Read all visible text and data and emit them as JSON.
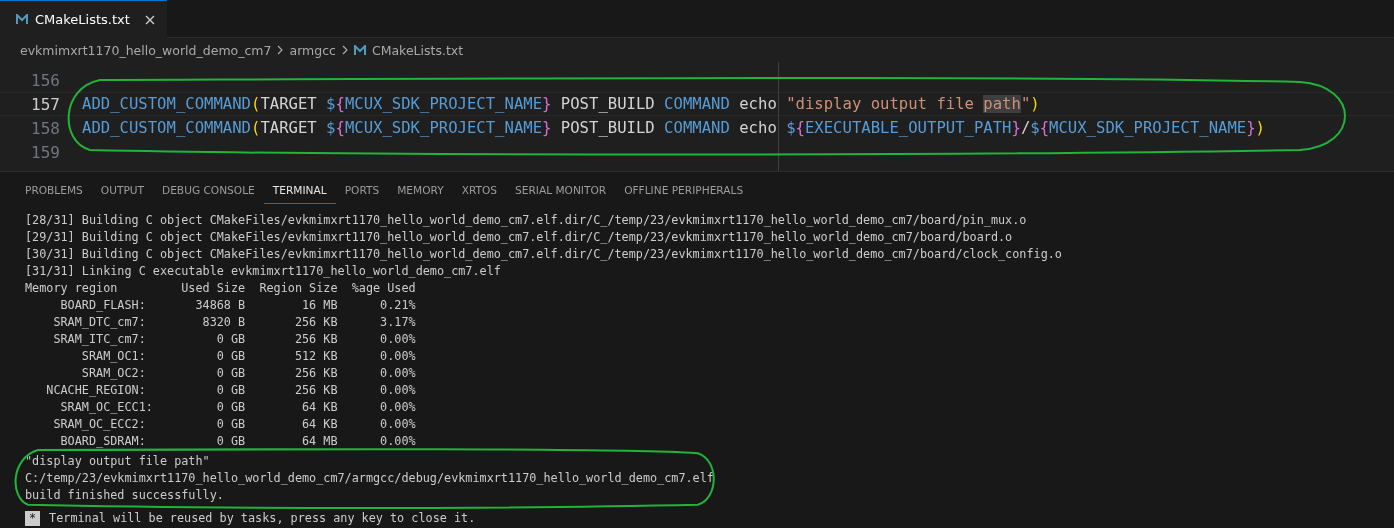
{
  "editor_tabs": [
    {
      "label": "CMakeLists.txt",
      "selected": true
    }
  ],
  "breadcrumb": [
    "evkmimxrt1170_hello_world_demo_cm7",
    "armgcc",
    "CMakeLists.txt"
  ],
  "code_lines": [
    {
      "number": "156",
      "current": false
    },
    {
      "number": "157",
      "current": true,
      "tokens": [
        {
          "kind": "keyword",
          "text": "ADD_CUSTOM_COMMAND"
        },
        {
          "kind": "paren",
          "text": "("
        },
        {
          "kind": "plain",
          "text": "TARGET "
        },
        {
          "kind": "keyword",
          "text": "$"
        },
        {
          "kind": "brace",
          "text": "{"
        },
        {
          "kind": "keyword",
          "text": "MCUX_SDK_PROJECT_NAME"
        },
        {
          "kind": "brace",
          "text": "}"
        },
        {
          "kind": "plain",
          "text": " POST_BUILD "
        },
        {
          "kind": "keyword",
          "text": "COMMAND"
        },
        {
          "kind": "plain",
          "text": " echo "
        },
        {
          "kind": "string",
          "text": "\"display output file "
        },
        {
          "kind": "string",
          "text": "path",
          "highlighted": true
        },
        {
          "kind": "string",
          "text": "\""
        },
        {
          "kind": "paren",
          "text": ")"
        }
      ]
    },
    {
      "number": "158",
      "current": false,
      "tokens": [
        {
          "kind": "keyword",
          "text": "ADD_CUSTOM_COMMAND"
        },
        {
          "kind": "paren",
          "text": "("
        },
        {
          "kind": "plain",
          "text": "TARGET "
        },
        {
          "kind": "keyword",
          "text": "$"
        },
        {
          "kind": "brace",
          "text": "{"
        },
        {
          "kind": "keyword",
          "text": "MCUX_SDK_PROJECT_NAME"
        },
        {
          "kind": "brace",
          "text": "}"
        },
        {
          "kind": "plain",
          "text": " POST_BUILD "
        },
        {
          "kind": "keyword",
          "text": "COMMAND"
        },
        {
          "kind": "plain",
          "text": " echo "
        },
        {
          "kind": "keyword",
          "text": "$"
        },
        {
          "kind": "brace",
          "text": "{"
        },
        {
          "kind": "keyword",
          "text": "EXECUTABLE_OUTPUT_PATH"
        },
        {
          "kind": "brace",
          "text": "}"
        },
        {
          "kind": "plain",
          "text": "/"
        },
        {
          "kind": "keyword",
          "text": "$"
        },
        {
          "kind": "brace",
          "text": "{"
        },
        {
          "kind": "keyword",
          "text": "MCUX_SDK_PROJECT_NAME"
        },
        {
          "kind": "brace",
          "text": "}"
        },
        {
          "kind": "paren",
          "text": ")"
        }
      ]
    },
    {
      "number": "159",
      "current": false
    }
  ],
  "panel_tabs": [
    {
      "label": "PROBLEMS",
      "selected": false
    },
    {
      "label": "OUTPUT",
      "selected": false
    },
    {
      "label": "DEBUG CONSOLE",
      "selected": false
    },
    {
      "label": "TERMINAL",
      "selected": true
    },
    {
      "label": "PORTS",
      "selected": false
    },
    {
      "label": "MEMORY",
      "selected": false
    },
    {
      "label": "XRTOS",
      "selected": false
    },
    {
      "label": "SERIAL MONITOR",
      "selected": false
    },
    {
      "label": "OFFLINE PERIPHERALS",
      "selected": false
    }
  ],
  "terminal_lines": [
    "[28/31] Building C object CMakeFiles/evkmimxrt1170_hello_world_demo_cm7.elf.dir/C_/temp/23/evkmimxrt1170_hello_world_demo_cm7/board/pin_mux.o",
    "[29/31] Building C object CMakeFiles/evkmimxrt1170_hello_world_demo_cm7.elf.dir/C_/temp/23/evkmimxrt1170_hello_world_demo_cm7/board/board.o",
    "[30/31] Building C object CMakeFiles/evkmimxrt1170_hello_world_demo_cm7.elf.dir/C_/temp/23/evkmimxrt1170_hello_world_demo_cm7/board/clock_config.o",
    "[31/31] Linking C executable evkmimxrt1170_hello_world_demo_cm7.elf",
    "Memory region         Used Size  Region Size  %age Used",
    "     BOARD_FLASH:       34868 B        16 MB      0.21%",
    "    SRAM_DTC_cm7:        8320 B       256 KB      3.17%",
    "    SRAM_ITC_cm7:          0 GB       256 KB      0.00%",
    "        SRAM_OC1:          0 GB       512 KB      0.00%",
    "        SRAM_OC2:          0 GB       256 KB      0.00%",
    "   NCACHE_REGION:          0 GB       256 KB      0.00%",
    "     SRAM_OC_ECC1:         0 GB        64 KB      0.00%",
    "    SRAM_OC_ECC2:          0 GB        64 KB      0.00%",
    "     BOARD_SDRAM:          0 GB        64 MB      0.00%"
  ],
  "highlighted_output": [
    "\"display output file path\"",
    "C:/temp/23/evkmimxrt1170_hello_world_demo_cm7/armgcc/debug/evkmimxrt1170_hello_world_demo_cm7.elf",
    "build finished successfully."
  ],
  "terminal_notice": {
    "badge": "*",
    "text": "Terminal will be reused by tasks, press any key to close it."
  }
}
